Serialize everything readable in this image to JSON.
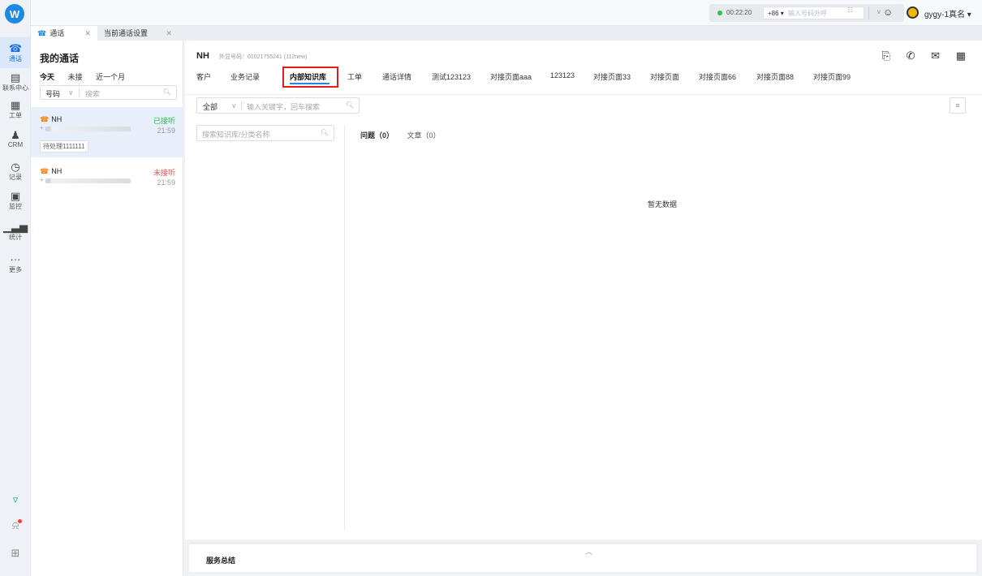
{
  "nav": {
    "logo": "W",
    "items": [
      {
        "icon": "phone-icon",
        "glyph": "📞",
        "label": "通话",
        "active": true
      },
      {
        "icon": "contacts-icon",
        "glyph": "▤",
        "label": "联系中心"
      },
      {
        "icon": "ticket-icon",
        "glyph": "▦",
        "label": "工单"
      },
      {
        "icon": "crm-icon",
        "glyph": "♟",
        "label": "CRM"
      },
      {
        "icon": "history-icon",
        "glyph": "◷",
        "label": "记录"
      },
      {
        "icon": "monitor-icon",
        "glyph": "⌂",
        "label": "监控"
      },
      {
        "icon": "stats-icon",
        "glyph": "▮",
        "label": "统计"
      },
      {
        "icon": "more-icon",
        "glyph": "···",
        "label": "更多"
      }
    ]
  },
  "header": {
    "call_timer": "00:22:20",
    "country_code": "+86 ▾",
    "dial_placeholder": "输入号码外呼",
    "username": "gygy-1真名 ▾"
  },
  "tabs": [
    {
      "label": "通话"
    },
    {
      "label": "当前通话设置"
    }
  ],
  "calls_panel": {
    "title": "我的通话",
    "filters": [
      "今天",
      "未接",
      "近一个月"
    ],
    "search_type": "号码",
    "search_placeholder": "搜索",
    "items": [
      {
        "name": "NH",
        "status": "已接听",
        "time": "21:59",
        "tag": "待处理1111111"
      },
      {
        "name": "NH",
        "status": "未接听",
        "time": "21:59"
      }
    ]
  },
  "main": {
    "contact_name": "NH",
    "ext_label": "外显号码：01021755241 (112new)",
    "subtabs": [
      "客户",
      "业务记录",
      "内部知识库",
      "工单",
      "通话详情",
      "测试123123",
      "对接页面aaa",
      "123123",
      "对接页面33",
      "对接页面",
      "对接页面66",
      "对接页面88",
      "对接页面99"
    ],
    "active_subtab": "内部知识库",
    "scope_select": "全部",
    "keyword_placeholder": "输入关键字，回车搜索",
    "kb_search_placeholder": "搜索知识库/分类名称",
    "question_label": "问题（0）",
    "article_label": "文章（0）",
    "empty_text": "暂无数据"
  },
  "summary": {
    "title": "服务总结"
  }
}
